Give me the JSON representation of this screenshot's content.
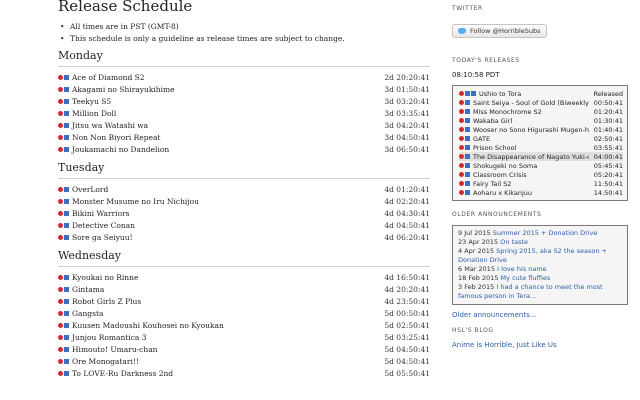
{
  "title": "Release Schedule",
  "notes": [
    "All times are in PST (GMT-8)",
    "This schedule is only a guideline as release times are subject to change."
  ],
  "days": [
    {
      "name": "Monday",
      "shows": [
        {
          "name": "Ace of Diamond S2",
          "time": "2d 20:20:41"
        },
        {
          "name": "Akagami no Shirayukihime",
          "time": "3d 01:50:41"
        },
        {
          "name": "Teekyu S5",
          "time": "3d 03:20:41"
        },
        {
          "name": "Million Doll",
          "time": "3d 03:35:41"
        },
        {
          "name": "Jitsu wa Watashi wa",
          "time": "3d 04:20:41"
        },
        {
          "name": "Non Non Biyori Repeat",
          "time": "3d 04:50:41"
        },
        {
          "name": "Joukamachi no Dandelion",
          "time": "3d 06:50:41"
        }
      ]
    },
    {
      "name": "Tuesday",
      "shows": [
        {
          "name": "OverLord",
          "time": "4d 01:20:41"
        },
        {
          "name": "Monster Musume no Iru Nichijou",
          "time": "4d 02:20:41"
        },
        {
          "name": "Bikini Warriors",
          "time": "4d 04:30:41"
        },
        {
          "name": "Detective Conan",
          "time": "4d 04:50:41"
        },
        {
          "name": "Sore ga Seiyuu!",
          "time": "4d 06:20:41"
        }
      ]
    },
    {
      "name": "Wednesday",
      "shows": [
        {
          "name": "Kyoukai no Rinne",
          "time": "4d 16:50:41"
        },
        {
          "name": "Gintama",
          "time": "4d 20:20:41"
        },
        {
          "name": "Robot Girls Z Plus",
          "time": "4d 23:50:41"
        },
        {
          "name": "Gangsta",
          "time": "5d 00:50:41"
        },
        {
          "name": "Kuusen Madoushi Kouhosei no Kyoukan",
          "time": "5d 02:50:41"
        },
        {
          "name": "Junjou Romantica 3",
          "time": "5d 03:25:41"
        },
        {
          "name": "Himouto! Umaru-chan",
          "time": "5d 04:50:41"
        },
        {
          "name": "Ore Monogatari!!",
          "time": "5d 04:50:41"
        },
        {
          "name": "To LOVE-Ru Darkness 2nd",
          "time": "5d 05:50:41"
        }
      ]
    }
  ],
  "sidebar": {
    "twitter_heading": "TWITTER",
    "follow_label": "Follow @HorribleSubs",
    "today_heading": "TODAY'S RELEASES",
    "pdt": "08:10:58 PDT",
    "released_label": "Released",
    "releases": [
      {
        "name": "Ushio to Tora",
        "time": ""
      },
      {
        "name": "Saint Seiya - Soul of Gold (Biweekly)",
        "time": "00:50:41"
      },
      {
        "name": "Miss Monochrome S2",
        "time": "01:20:41"
      },
      {
        "name": "Wakaba Girl",
        "time": "01:30:41"
      },
      {
        "name": "Wooser no Sono Higurashi Mugen-hen",
        "time": "01:40:41"
      },
      {
        "name": "GATE",
        "time": "02:50:41"
      },
      {
        "name": "Prison School",
        "time": "03:55:41"
      },
      {
        "name": "The Disappearance of Nagato Yuki-chan",
        "time": "04:00:41"
      },
      {
        "name": "Shokugeki no Soma",
        "time": "05:45:41"
      },
      {
        "name": "Classroom Crisis",
        "time": "05:20:41"
      },
      {
        "name": "Fairy Tail S2",
        "time": "11:50:41"
      },
      {
        "name": "Aoharu x Kikanjuu",
        "time": "14:50:41"
      }
    ],
    "older_heading": "OLDER ANNOUNCEMENTS",
    "announcements": [
      {
        "date": "9 Jul 2015",
        "text": "Summer 2015 + Donation Drive"
      },
      {
        "date": "23 Apr 2015",
        "text": "On taste"
      },
      {
        "date": "4 Apr 2015",
        "text": "Spring 2015, aka S2 the season + Donation Drive"
      },
      {
        "date": "6 Mar 2015",
        "text": "I love his name"
      },
      {
        "date": "18 Feb 2015",
        "text": "My cute fluffies"
      },
      {
        "date": "3 Feb 2015",
        "text": "I had a chance to meet the most famous person in Tera..."
      }
    ],
    "older_link": "Older announcements...",
    "blog_heading": "HSL'S BLOG",
    "blog_link": "Anime is Horrible, Just Like Us"
  }
}
